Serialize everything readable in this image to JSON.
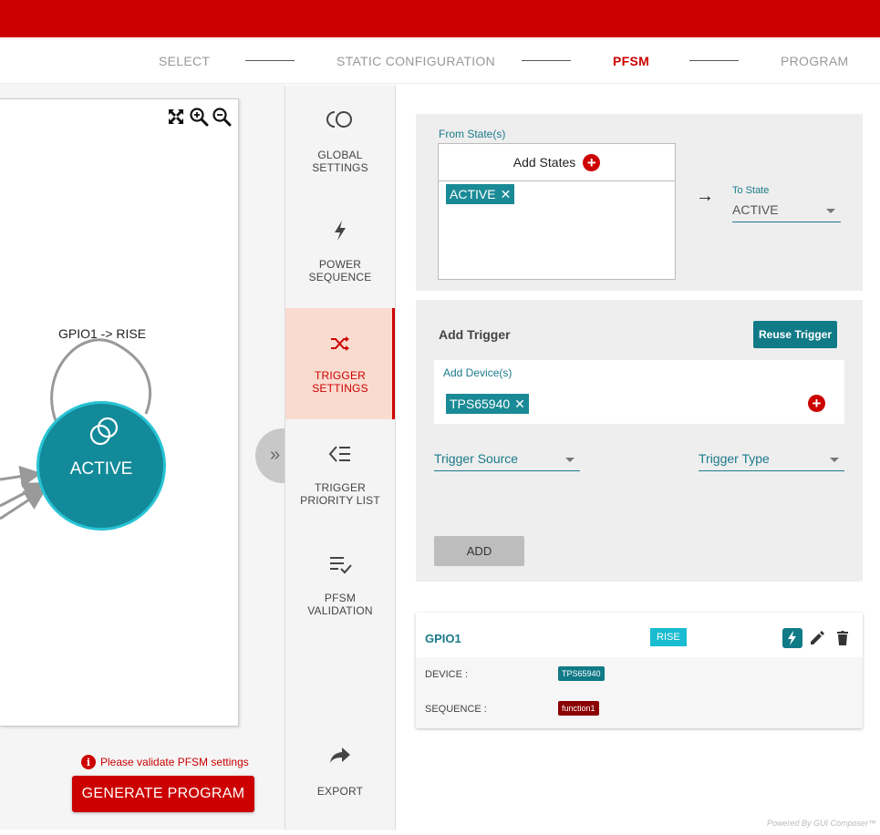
{
  "colors": {
    "brand": "#cc0000",
    "teal": "#1a8a96",
    "state_node": "#138a99"
  },
  "stepper": {
    "steps": [
      {
        "label": "SELECT"
      },
      {
        "label": "STATIC CONFIGURATION"
      },
      {
        "label": "PFSM"
      },
      {
        "label": "PROGRAM"
      }
    ],
    "active_step": "PFSM"
  },
  "diagram": {
    "zoom_controls": [
      "fit-screen-icon",
      "zoom-in-icon",
      "zoom-out-icon"
    ],
    "transition_label": "GPIO1 -> RISE",
    "state_node": {
      "label": "ACTIVE",
      "icon": "state-cycle-icon"
    }
  },
  "validation": {
    "message": "Please validate PFSM settings",
    "icon": "info-icon"
  },
  "generate_button": "GENERATE PROGRAM",
  "nav": {
    "items": [
      {
        "label_line1": "GLOBAL",
        "label_line2": "SETTINGS",
        "icon": "global-settings-icon"
      },
      {
        "label_line1": "POWER",
        "label_line2": "SEQUENCE",
        "icon": "lightning-icon"
      },
      {
        "label_line1": "TRIGGER",
        "label_line2": "SETTINGS",
        "icon": "shuffle-icon"
      },
      {
        "label_line1": "TRIGGER",
        "label_line2": "PRIORITY LIST",
        "icon": "priority-list-icon"
      },
      {
        "label_line1": "PFSM",
        "label_line2": "VALIDATION",
        "icon": "list-check-icon"
      },
      {
        "label_line1": "EXPORT",
        "label_line2": "",
        "icon": "share-arrow-icon"
      }
    ],
    "active_index": 2
  },
  "states": {
    "from_label": "From State(s)",
    "add_states_label": "Add States",
    "from_chips": [
      "ACTIVE"
    ],
    "to_label": "To State",
    "to_value": "ACTIVE"
  },
  "trigger": {
    "title": "Add Trigger",
    "reuse_button": "Reuse Trigger",
    "add_devices_label": "Add Device(s)",
    "device_chips": [
      "TPS65940"
    ],
    "source_placeholder": "Trigger Source",
    "type_placeholder": "Trigger Type",
    "add_button": "ADD"
  },
  "result": {
    "name": "GPIO1",
    "edge": "RISE",
    "device_label": "DEVICE :",
    "device_value": "TPS65940",
    "sequence_label": "SEQUENCE :",
    "sequence_value": "function1"
  },
  "footer": {
    "powered_by": "Powered By GUI Composer™"
  }
}
